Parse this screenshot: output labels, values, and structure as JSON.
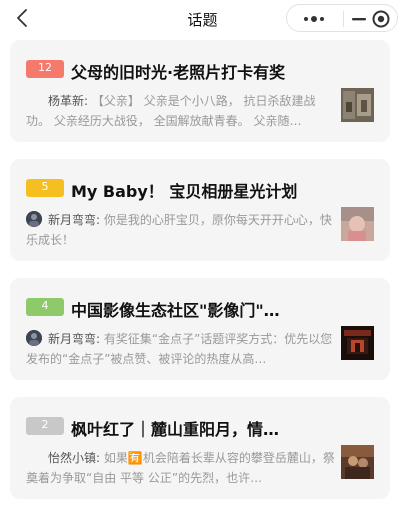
{
  "nav": {
    "title": "话题"
  },
  "topics": [
    {
      "rank": "12",
      "badge_color": "#f57a6b",
      "title": "父母的旧时光·老照片打卡有奖",
      "author": "杨革新:",
      "excerpt": "【父亲】 父亲是个小八路， 抗日杀敌建战功。 父亲经历大战役， 全国解放献青春。 父亲随…",
      "has_avatar": false
    },
    {
      "rank": "5",
      "badge_color": "#f5bf1f",
      "title": "My Baby！ 宝贝相册星光计划",
      "author": "新月弯弯:",
      "excerpt": "你是我的心肝宝贝，原你每天开开心心，快乐成长！",
      "has_avatar": true
    },
    {
      "rank": "4",
      "badge_color": "#8ec96a",
      "title": "中国影像生态社区\"影像门\"…",
      "author": "新月弯弯:",
      "excerpt": "有奖征集“金点子”话题评奖方式：优先以您发布的“金点子”被点赞、被评论的热度从高…",
      "has_avatar": true
    },
    {
      "rank": "2",
      "badge_color": "#c8c8c8",
      "title": "枫叶红了｜麓山重阳月，情…",
      "author": "怡然小镇:",
      "excerpt": "如果🈶机会陪着长辈从容的攀登岳麓山，祭奠着为争取“自由 平等 公正”的先烈，也许…",
      "has_avatar": false
    }
  ]
}
